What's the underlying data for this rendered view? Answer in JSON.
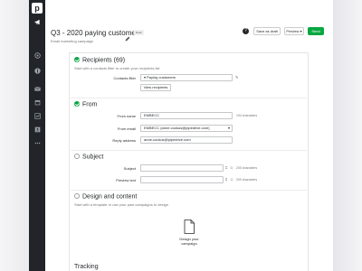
{
  "app": {
    "logo_letter": "p"
  },
  "sidebar": {
    "items": [
      {
        "icon": "megaphone-icon",
        "active": true
      },
      {
        "icon": "target-icon",
        "active": false
      },
      {
        "icon": "dollar-icon",
        "active": false
      },
      {
        "icon": "mail-icon",
        "active": false
      },
      {
        "icon": "calendar-icon",
        "active": false
      },
      {
        "icon": "chart-icon",
        "active": false
      },
      {
        "icon": "contacts-icon",
        "active": false
      },
      {
        "icon": "more-icon",
        "active": false
      }
    ]
  },
  "header": {
    "title": "Q3 - 2020 paying customers",
    "badge": "Draft",
    "subtitle": "Email marketing campaign",
    "help": "?",
    "save_draft": "Save as draft",
    "preview": "Preview",
    "send": "Send"
  },
  "recipients": {
    "title": "Recipients (69)",
    "desc": "Start with a contacts filter to create your recipients list",
    "filter_label": "Contacts filter",
    "filter_value": "Paying customers",
    "view_button": "View recipients"
  },
  "from": {
    "title": "From",
    "name_label": "From name",
    "name_value": "EMBECC",
    "name_counter": "194 characters",
    "email_label": "From email",
    "email_value": "EMBECC (anne.cookus@pipedrive.com)",
    "reply_label": "Reply address",
    "reply_value": "anne.cookus@pipedrive.com"
  },
  "subject": {
    "title": "Subject",
    "subject_label": "Subject",
    "subject_counter": "200 characters",
    "preview_label": "Preview text",
    "preview_counter": "200 characters"
  },
  "design": {
    "title": "Design and content",
    "desc": "Start with a template or use your past campaigns to design",
    "card_label": "Design your campaign"
  },
  "tracking": {
    "title": "Tracking"
  }
}
